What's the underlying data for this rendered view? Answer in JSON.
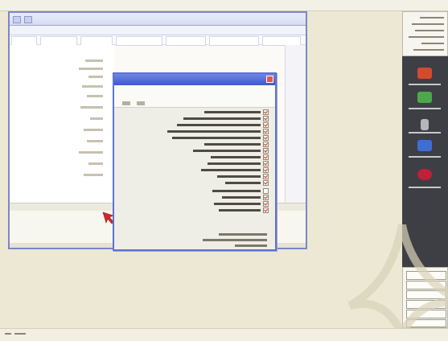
{
  "colors": {
    "accent": "#5d73d1",
    "window_border": "#7b86c9",
    "sidebar_bg": "#3e3f44",
    "dialog_bg": "#efeee6",
    "check_mark": "#c83428"
  },
  "icons": [
    "red-arrow-icon",
    "cursor-icon",
    "dialog-close-icon",
    "sidebar-red-icon",
    "sidebar-green-icon",
    "sidebar-blue-icon",
    "sidebar-cube-icon"
  ],
  "dialog": {
    "options": [
      {
        "checked": true
      },
      {
        "checked": true
      },
      {
        "checked": true
      },
      {
        "checked": true
      },
      {
        "checked": true
      },
      {
        "checked": true
      },
      {
        "checked": true
      },
      {
        "checked": true
      },
      {
        "checked": true
      },
      {
        "checked": true
      },
      {
        "checked": true
      },
      {
        "checked": true
      },
      {
        "checked": false
      },
      {
        "checked": true
      },
      {
        "checked": true
      },
      {
        "checked": true
      }
    ]
  }
}
